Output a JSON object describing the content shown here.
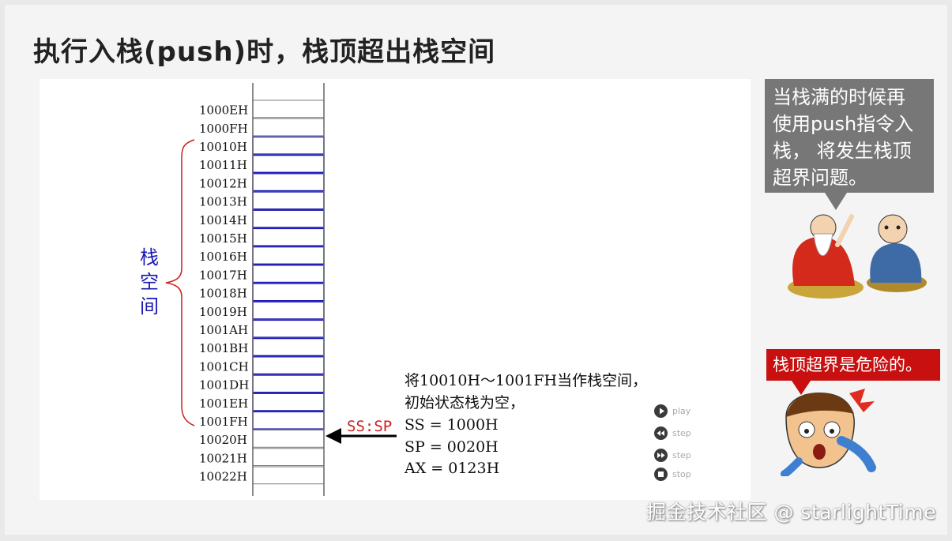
{
  "title": "执行入栈(push)时，栈顶超出栈空间",
  "stack": {
    "addresses": [
      "1000EH",
      "1000FH",
      "10010H",
      "10011H",
      "10012H",
      "10013H",
      "10014H",
      "10015H",
      "10016H",
      "10017H",
      "10018H",
      "10019H",
      "1001AH",
      "1001BH",
      "1001CH",
      "1001DH",
      "1001EH",
      "1001FH",
      "10020H",
      "10021H",
      "10022H"
    ],
    "space_label": [
      "栈",
      "空",
      "间"
    ],
    "pointer_label": "SS:SP",
    "colors": {
      "stack_space": "#1818b0",
      "brace": "#cc1f1f",
      "pointer": "#cc1f1f"
    }
  },
  "info": {
    "lines": [
      "将10010H～1001FH当作栈空间，",
      "初始状态栈为空，",
      "SS = 1000H",
      "SP = 0020H",
      "AX = 0123H"
    ]
  },
  "controls": [
    {
      "label": "play",
      "icon": "play-icon"
    },
    {
      "label": "step",
      "icon": "step-back-icon"
    },
    {
      "label": "step",
      "icon": "step-forward-icon"
    },
    {
      "label": "stop",
      "icon": "stop-icon"
    }
  ],
  "bubble_top": {
    "lines": [
      "当栈满的时候再",
      "使用push指令入",
      "栈， 将发生栈顶",
      "超界问题。"
    ]
  },
  "bubble_bottom": {
    "text": "栈顶超界是危险的。"
  },
  "watermark": "掘金技术社区 @ starlightTime"
}
